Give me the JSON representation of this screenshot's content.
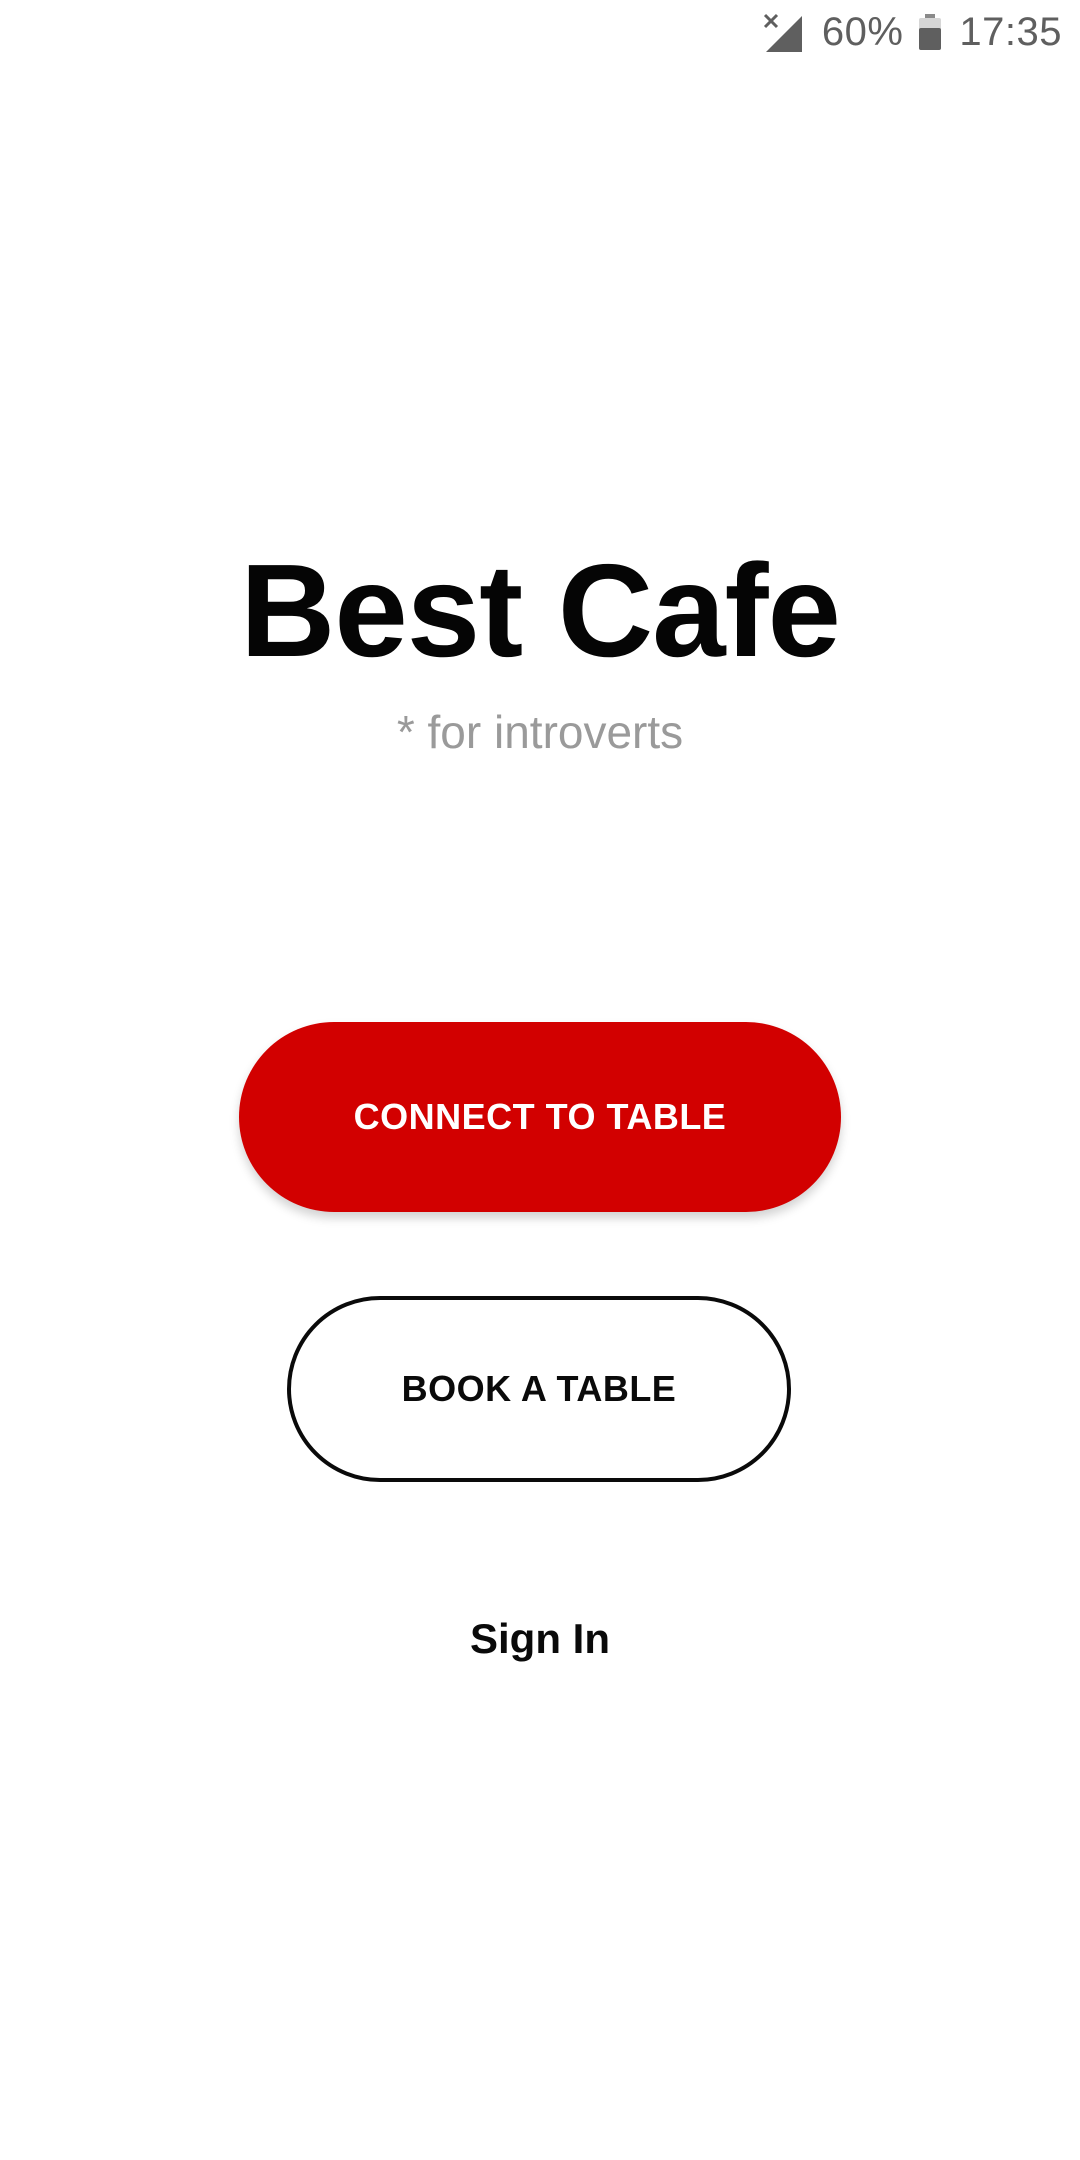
{
  "status_bar": {
    "battery_percent": "60%",
    "time": "17:35",
    "icons": [
      "signal-no-service-icon",
      "battery-icon"
    ],
    "text_color": "#5f5f5f"
  },
  "app": {
    "title": "Best Cafe",
    "subtitle": "* for introverts"
  },
  "actions": {
    "connect_label": "CONNECT TO TABLE",
    "book_label": "BOOK A TABLE",
    "sign_in_label": "Sign In"
  },
  "colors": {
    "primary": "#d20000",
    "text": "#0a0a0a",
    "subtitle": "#9a9a9a",
    "background": "#ffffff"
  }
}
